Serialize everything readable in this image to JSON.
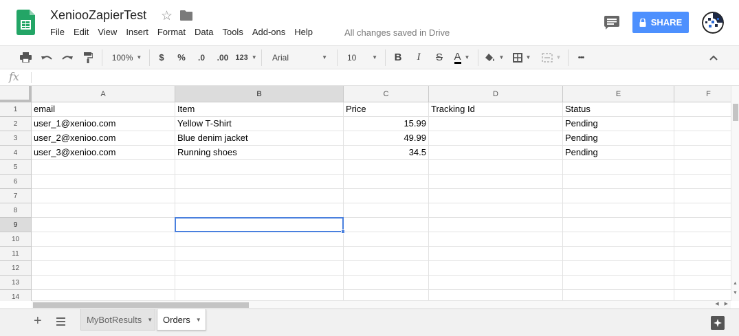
{
  "header": {
    "title": "XeniooZapierTest",
    "saved_status": "All changes saved in Drive",
    "share_label": "SHARE",
    "accent_color": "#4d90fe"
  },
  "menu": [
    "File",
    "Edit",
    "View",
    "Insert",
    "Format",
    "Data",
    "Tools",
    "Add-ons",
    "Help"
  ],
  "toolbar": {
    "zoom": "100%",
    "currency": "$",
    "percent": "%",
    "decrease_decimals": ".0",
    "increase_decimals": ".00",
    "more_formats": "123",
    "font": "Arial",
    "font_size": "10",
    "bold": "B",
    "italic": "I",
    "strikethrough": "S",
    "text_color": "A",
    "more": "•••"
  },
  "formula_bar": {
    "label": "fx",
    "value": ""
  },
  "columns": [
    "A",
    "B",
    "C",
    "D",
    "E",
    "F"
  ],
  "row_numbers": [
    "1",
    "2",
    "3",
    "4",
    "5",
    "6",
    "7",
    "8",
    "9",
    "10",
    "11",
    "12",
    "13",
    "14"
  ],
  "rows": [
    [
      "email",
      "Item",
      "Price",
      "Tracking Id",
      "Status",
      ""
    ],
    [
      "user_1@xenioo.com",
      "Yellow T-Shirt",
      "15.99",
      "",
      "Pending",
      ""
    ],
    [
      "user_2@xenioo.com",
      "Blue denim jacket",
      "49.99",
      "",
      "Pending",
      ""
    ],
    [
      "user_3@xenioo.com",
      "Running shoes",
      "34.5",
      "",
      "Pending",
      ""
    ]
  ],
  "selected_cell": "B9",
  "sheets": [
    {
      "name": "MyBotResults",
      "active": false
    },
    {
      "name": "Orders",
      "active": true
    }
  ]
}
